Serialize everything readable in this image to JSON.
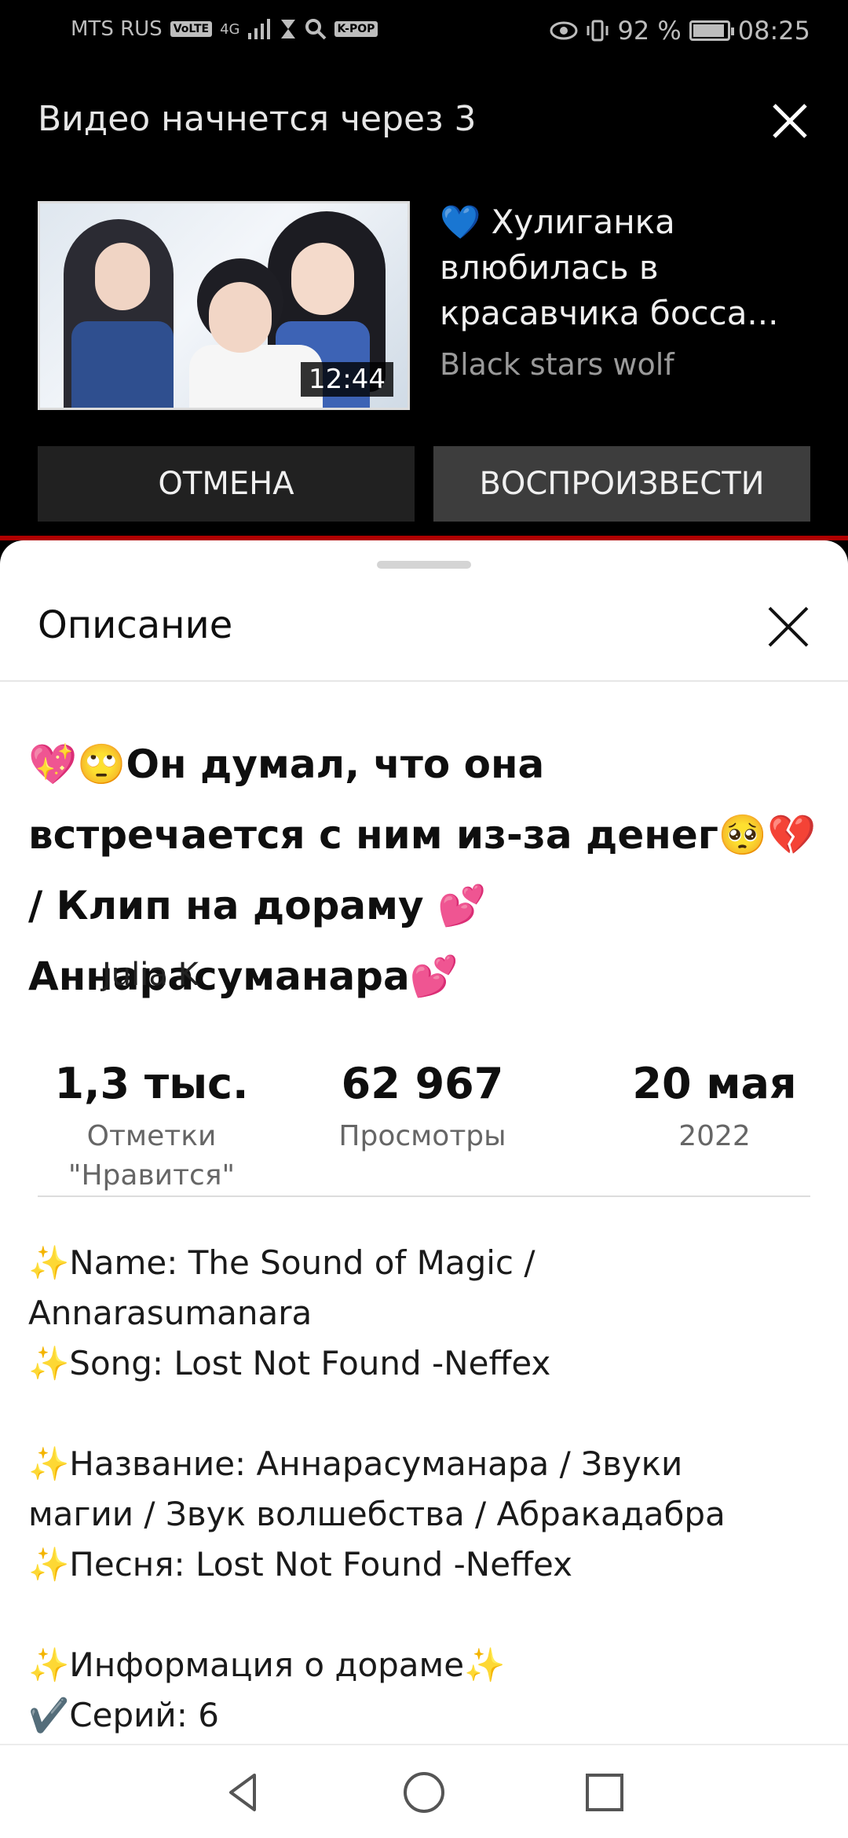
{
  "status_bar": {
    "carrier": "MTS RUS",
    "volte": "VoLTE",
    "network": "4G",
    "kpop_badge": "K-POP",
    "battery_percent": "92 %",
    "battery_level": 0.92,
    "time": "08:25"
  },
  "up_next": {
    "countdown_text": "Видео начнется через 3",
    "video_title": "💙 Хулиганка влюбилась в красавчика босса...",
    "channel": "Black stars wolf",
    "duration": "12:44",
    "cancel_label": "ОТМЕНА",
    "play_label": "ВОСПРОИЗВЕСТИ"
  },
  "description_panel": {
    "title": "Описание",
    "video_title": "💖🙄Он думал, что она встречается с ним из-за денег🥺💔 / Клип на дораму 💕Аннарасуманара💕",
    "author": "Julia K",
    "stats": {
      "likes_value": "1,3 тыс.",
      "likes_label": "Отметки \"Нравится\"",
      "views_value": "62 967",
      "views_label": "Просмотры",
      "date_value": "20 мая",
      "date_year": "2022"
    },
    "description_lines": [
      "✨Name: The Sound of Magic /",
      "Annarasumanara",
      "✨Song:  Lost Not Found -Neffex",
      "",
      "✨Название: Аннарасуманара / Звуки",
      "магии / Звук волшебства / Абракадабра",
      "✨Песня: Lost Not Found -Neffex",
      "",
      "✨Информация о дораме✨",
      "✔️Серий: 6"
    ]
  },
  "colors": {
    "overlay_bg": "#000000",
    "accent_red": "#b00000",
    "sheet_bg": "#ffffff"
  },
  "icons": {
    "close": "close-icon",
    "back": "back-triangle-icon",
    "home": "home-circle-icon",
    "recents": "recents-square-icon"
  }
}
